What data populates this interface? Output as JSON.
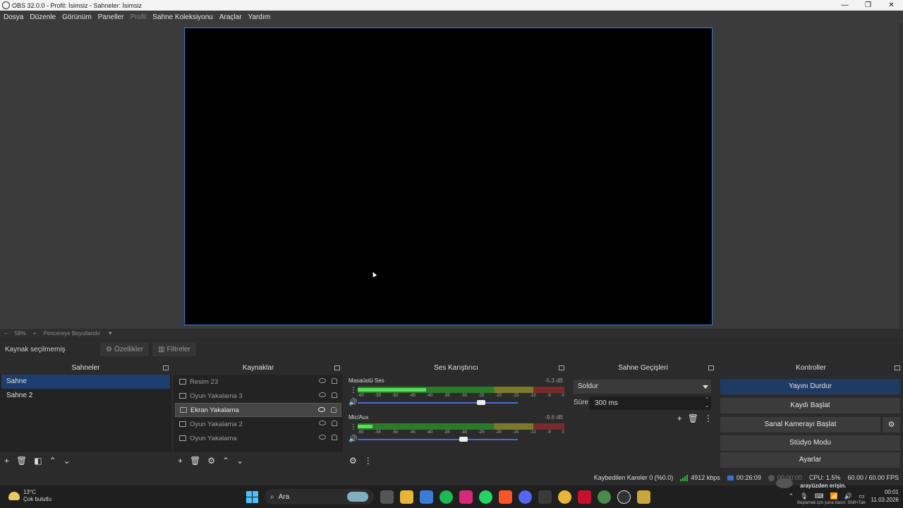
{
  "window": {
    "title": "OBS 32.0.0 - Profil: İsimsiz - Sahneler: İsimsiz",
    "buttons": [
      "—",
      "❐",
      "✕"
    ]
  },
  "menu": [
    {
      "label": "Dosya",
      "enabled": true
    },
    {
      "label": "Düzenle",
      "enabled": true
    },
    {
      "label": "Görünüm",
      "enabled": true
    },
    {
      "label": "Paneller",
      "enabled": true
    },
    {
      "label": "Profil",
      "enabled": false
    },
    {
      "label": "Sahne Koleksiyonu",
      "enabled": true
    },
    {
      "label": "Araçlar",
      "enabled": true
    },
    {
      "label": "Yardım",
      "enabled": true
    }
  ],
  "zoombar": {
    "minus": "−",
    "zoom": "58%",
    "plus": "+",
    "mode": "Pencereye Boyutlandır"
  },
  "source_toolbar": {
    "no_selection": "Kaynak seçilmemiş",
    "properties": "Özellikler",
    "filters": "Filtreler"
  },
  "scenes": {
    "title": "Sahneler",
    "items": [
      {
        "label": "Sahne",
        "active": true
      },
      {
        "label": "Sahne 2",
        "active": false
      }
    ]
  },
  "sources": {
    "title": "Kaynaklar",
    "items": [
      {
        "label": "Resim 23",
        "icon": "image-icon",
        "selected": false
      },
      {
        "label": "Oyun Yakalama 3",
        "icon": "gamepad-icon",
        "selected": false
      },
      {
        "label": "Ekran Yakalama",
        "icon": "monitor-icon",
        "selected": true
      },
      {
        "label": "Oyun Yakalama 2",
        "icon": "gamepad-icon",
        "selected": false
      },
      {
        "label": "Oyun Yakalama",
        "icon": "gamepad-icon",
        "selected": false
      }
    ]
  },
  "mixer": {
    "title": "Ses Karıştırıcı",
    "tracks": [
      {
        "name": "Masaüstü Ses",
        "db": "-5.3 dB",
        "level": 0.33,
        "fader": 0.74
      },
      {
        "name": "Mic/Aux",
        "db": "-9.6 dB",
        "level": 0.07,
        "fader": 0.63
      }
    ],
    "ticks": [
      "-60",
      "-55",
      "-50",
      "-45",
      "-40",
      "-35",
      "-30",
      "-25",
      "-20",
      "-15",
      "-10",
      "-5",
      "0"
    ]
  },
  "transitions": {
    "title": "Sahne Geçişleri",
    "selected": "Soldur",
    "duration_label": "Süre",
    "duration_value": "300 ms"
  },
  "controls": {
    "title": "Kontroller",
    "buttons": [
      "Yayını Durdur",
      "Kaydı Başlat",
      "Sanal Kamerayı Başlat",
      "Stüdyo Modu",
      "Ayarlar"
    ]
  },
  "status": {
    "dropped": "Kaybedilen Kareler 0 (%0.0)",
    "bitrate": "4912 kbps",
    "stream_time": "00:26:09",
    "rec_time": "00:00:00",
    "cpu": "CPU: 1.5%",
    "fps": "60.00 / 60.00 FPS"
  },
  "taskbar": {
    "temp": "13°C",
    "weather": "Çok bulutlu",
    "search": "Ara",
    "time": "00:01",
    "date": "11.03.2026",
    "notif_title": "arayüzden erişin.",
    "notif_sub": "Başlamak için şuna basın: Shift+Tab"
  },
  "colors": {
    "accent": "#3a7bd5",
    "selected_scene": "#1c3d6e",
    "stream_button": "#1f3a63"
  }
}
